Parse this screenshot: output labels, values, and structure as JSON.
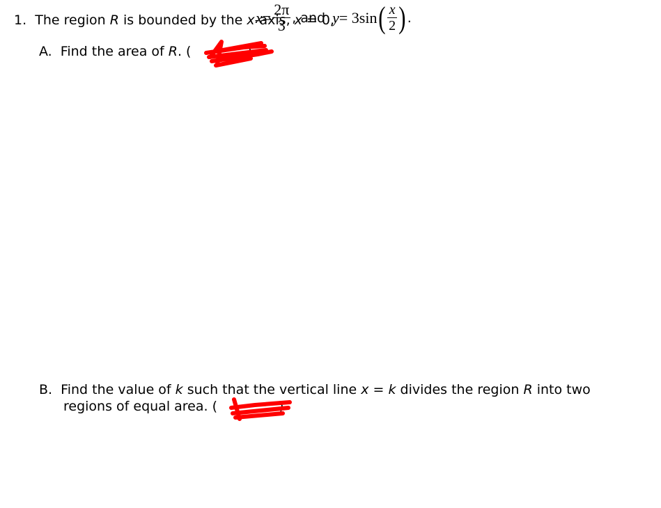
{
  "question": {
    "number": "1.",
    "intro_text": "The region ",
    "region_var": "R",
    "bounded_text": " is bounded by the ",
    "x_var": "x",
    "axis_text": "-axis, ",
    "eq1_x": "x",
    "eq1_rest": " = 0,",
    "eq2_x": "x",
    "eq2_eq": " =",
    "frac_num": "2π",
    "frac_den": "3",
    "and_text": ", and",
    "y_var": "y",
    "y_eq": " = 3sin",
    "inner_num": "x",
    "inner_den": "2",
    "end_period": "."
  },
  "part_a": {
    "label": "A.",
    "text": "Find the area of ",
    "var": "R",
    "after": ". (",
    "redacted_points": "redacted",
    "close": ")"
  },
  "part_b": {
    "label": "B.",
    "text1": "Find the value of ",
    "k": "k",
    "text2": " such that the vertical line ",
    "x": "x",
    "eq": " = ",
    "k2": "k",
    "text3": " divides the region ",
    "R": "R",
    "text4": " into two",
    "line2": "regions of equal area. (",
    "close": ")"
  },
  "colors": {
    "redaction": "#ff0000"
  }
}
